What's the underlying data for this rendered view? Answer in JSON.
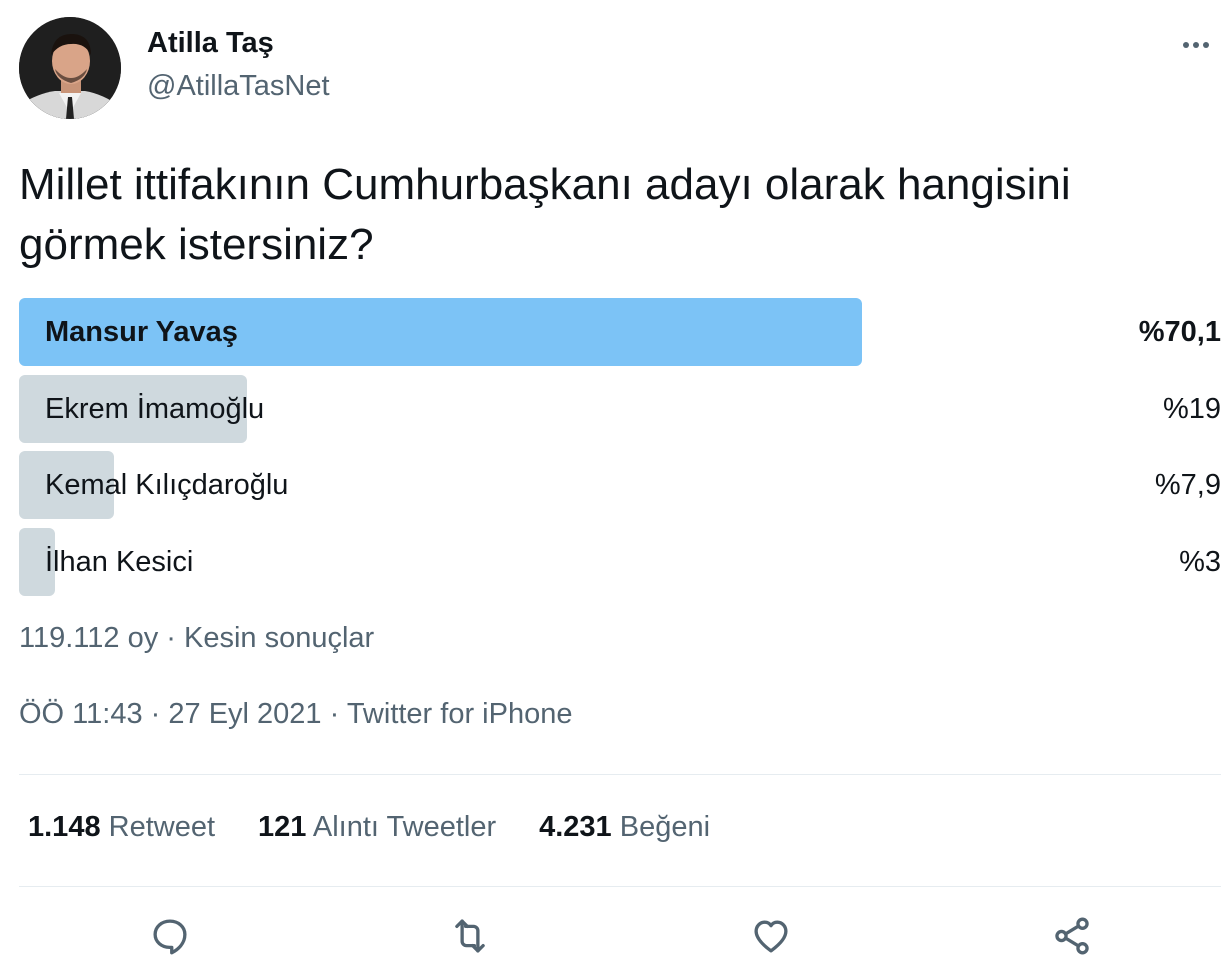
{
  "tweet": {
    "author": {
      "display_name": "Atilla Taş",
      "handle": "@AtillaTasNet"
    },
    "text": "Millet ittifakının Cumhurbaşkanı adayı olarak hangisini görmek istersiniz?",
    "poll": {
      "options": [
        {
          "label": "Mansur Yavaş",
          "percent_text": "%70,1",
          "percent": 70.1,
          "winner": true
        },
        {
          "label": "Ekrem İmamoğlu",
          "percent_text": "%19",
          "percent": 19,
          "winner": false
        },
        {
          "label": "Kemal Kılıçdaroğlu",
          "percent_text": "%7,9",
          "percent": 7.9,
          "winner": false
        },
        {
          "label": "İlhan Kesici",
          "percent_text": "%3",
          "percent": 3,
          "winner": false
        }
      ],
      "votes": "119.112 oy",
      "status": "Kesin sonuçlar"
    },
    "time": "ÖÖ 11:43",
    "date": "27 Eyl 2021",
    "source": "Twitter for iPhone",
    "stats": {
      "retweets": {
        "count": "1.148",
        "label": "Retweet"
      },
      "quotes": {
        "count": "121",
        "label": "Alıntı Tweetler"
      },
      "likes": {
        "count": "4.231",
        "label": "Beğeni"
      }
    },
    "actions": [
      "reply-icon",
      "retweet-icon",
      "like-icon",
      "share-icon"
    ]
  },
  "colors": {
    "winner_bar": "#7cc3f6",
    "other_bar": "#cfd9de",
    "secondary_text": "#536471",
    "primary_text": "#0f1419"
  }
}
